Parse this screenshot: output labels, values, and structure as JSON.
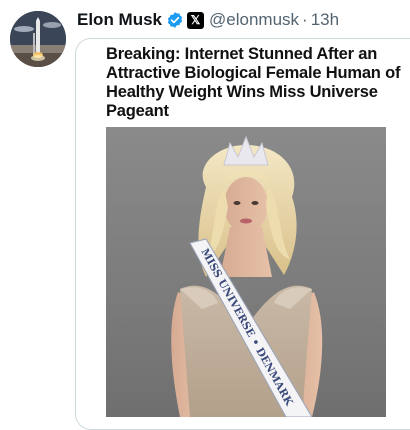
{
  "tweet": {
    "author_name": "Elon Musk",
    "handle": "@elonmusk",
    "separator": "·",
    "time": "13h",
    "verified_icon": "verified-badge-icon",
    "affiliate_icon": "x-logo-icon",
    "avatar_icon": "rocket-launch-avatar",
    "x_glyph": "𝕏"
  },
  "card": {
    "headline": "Breaking: Internet Stunned After an Attractive Biological Female Human of Healthy Weight Wins Miss Universe Pageant",
    "sash_text": "MISS UNIVERSE • DENMARK"
  },
  "colors": {
    "verified_blue": "#1d9bf0",
    "handle_gray": "#536471",
    "border": "#cfd9de"
  }
}
